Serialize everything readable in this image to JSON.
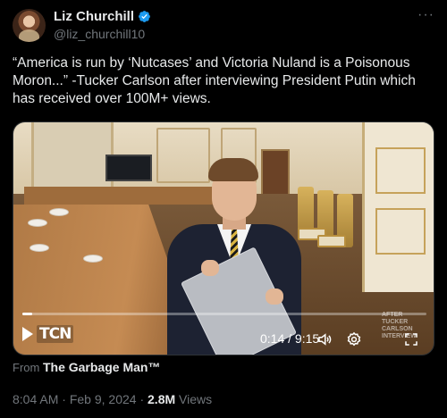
{
  "author": {
    "display_name": "Liz Churchill",
    "handle": "@liz_churchill10",
    "verified_badge": "verified-badge-icon",
    "badge_color": "#1d9bf0"
  },
  "tweet": {
    "text": "“America is run by ‘Nutcases’ and Victoria Nuland is a Poisonous Moron...” -Tucker Carlson after interviewing President Putin which has received over 100M+ views.",
    "more_menu": "···"
  },
  "video": {
    "logo_text": "TCN",
    "current_time": "0:14",
    "duration": "9:15",
    "time_separator": "/",
    "progress_fraction": 0.025,
    "watermark_lines": [
      "AFTER",
      "TUCKER",
      "CARLSON",
      "INTERVIEW"
    ],
    "controls": [
      "volume-icon",
      "settings-icon",
      "fullscreen-icon"
    ]
  },
  "source": {
    "prefix": "From",
    "name": "The Garbage Man™"
  },
  "meta": {
    "time": "8:04 AM",
    "date": "Feb 9, 2024",
    "separator": "·",
    "views_count": "2.8M",
    "views_label": "Views"
  },
  "colors": {
    "background": "#000000",
    "text_primary": "#e7e9ea",
    "text_secondary": "#71767b",
    "accent": "#1d9bf0"
  }
}
